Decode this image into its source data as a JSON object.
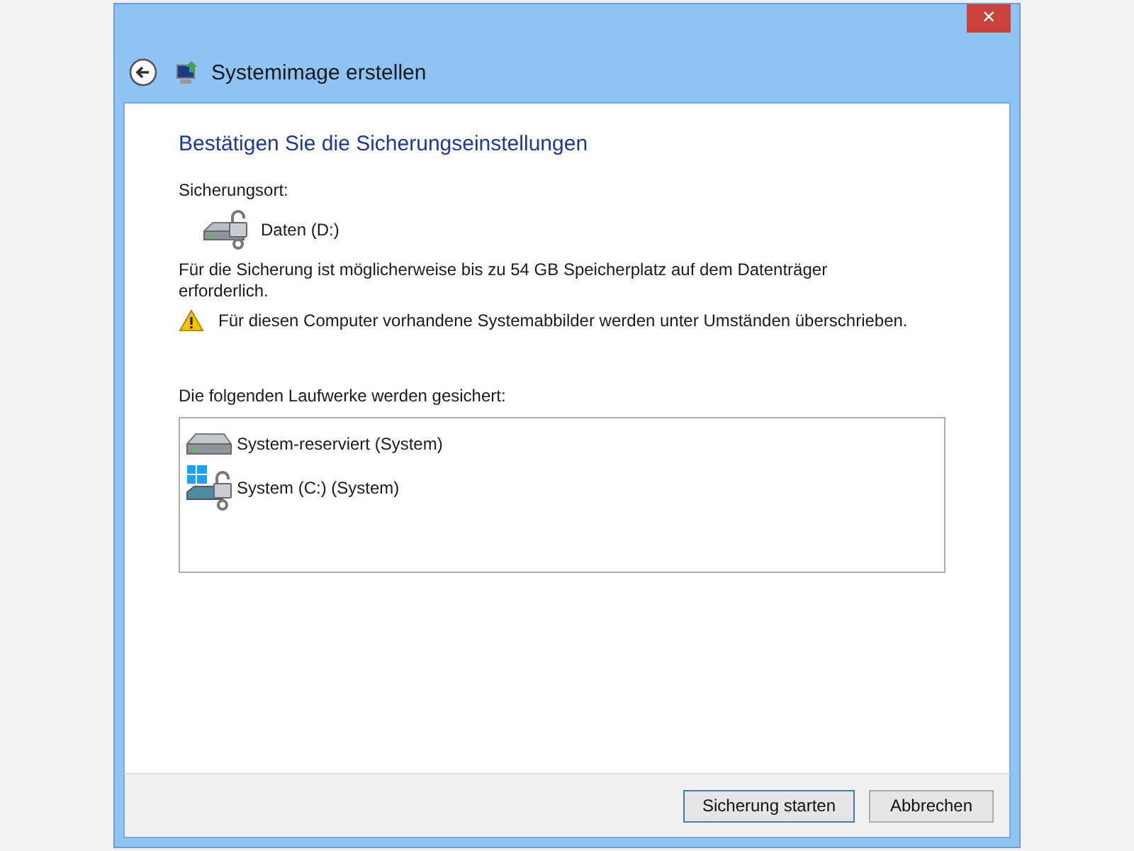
{
  "window": {
    "title": "Systemimage erstellen",
    "close": "×"
  },
  "heading": "Bestätigen Sie die Sicherungseinstellungen",
  "location_label": "Sicherungsort:",
  "location": "Daten (D:)",
  "space_note": "Für die Sicherung ist möglicherweise bis zu 54 GB Speicherplatz auf dem Datenträger erforderlich.",
  "warning": "Für diesen Computer vorhandene Systemabbilder werden unter Umständen überschrieben.",
  "drives_label": "Die folgenden Laufwerke werden gesichert:",
  "drives": [
    {
      "name": "System-reserviert (System)",
      "kind": "plain"
    },
    {
      "name": "System (C:) (System)",
      "kind": "windows"
    }
  ],
  "buttons": [
    {
      "label": "Sicherung starten",
      "default": true
    },
    {
      "label": "Abbrechen",
      "default": false
    }
  ]
}
